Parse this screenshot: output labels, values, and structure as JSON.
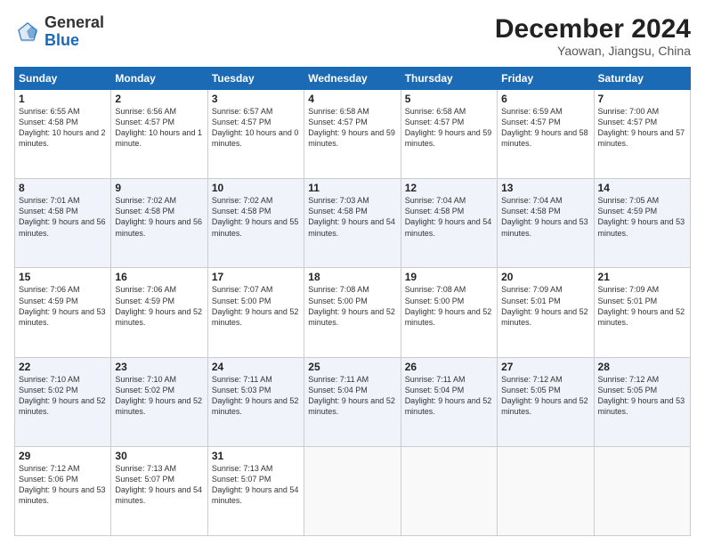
{
  "header": {
    "logo_general": "General",
    "logo_blue": "Blue",
    "month_title": "December 2024",
    "location": "Yaowan, Jiangsu, China"
  },
  "weekdays": [
    "Sunday",
    "Monday",
    "Tuesday",
    "Wednesday",
    "Thursday",
    "Friday",
    "Saturday"
  ],
  "weeks": [
    [
      {
        "day": "1",
        "sunrise": "Sunrise: 6:55 AM",
        "sunset": "Sunset: 4:58 PM",
        "daylight": "Daylight: 10 hours and 2 minutes."
      },
      {
        "day": "2",
        "sunrise": "Sunrise: 6:56 AM",
        "sunset": "Sunset: 4:57 PM",
        "daylight": "Daylight: 10 hours and 1 minute."
      },
      {
        "day": "3",
        "sunrise": "Sunrise: 6:57 AM",
        "sunset": "Sunset: 4:57 PM",
        "daylight": "Daylight: 10 hours and 0 minutes."
      },
      {
        "day": "4",
        "sunrise": "Sunrise: 6:58 AM",
        "sunset": "Sunset: 4:57 PM",
        "daylight": "Daylight: 9 hours and 59 minutes."
      },
      {
        "day": "5",
        "sunrise": "Sunrise: 6:58 AM",
        "sunset": "Sunset: 4:57 PM",
        "daylight": "Daylight: 9 hours and 59 minutes."
      },
      {
        "day": "6",
        "sunrise": "Sunrise: 6:59 AM",
        "sunset": "Sunset: 4:57 PM",
        "daylight": "Daylight: 9 hours and 58 minutes."
      },
      {
        "day": "7",
        "sunrise": "Sunrise: 7:00 AM",
        "sunset": "Sunset: 4:57 PM",
        "daylight": "Daylight: 9 hours and 57 minutes."
      }
    ],
    [
      {
        "day": "8",
        "sunrise": "Sunrise: 7:01 AM",
        "sunset": "Sunset: 4:58 PM",
        "daylight": "Daylight: 9 hours and 56 minutes."
      },
      {
        "day": "9",
        "sunrise": "Sunrise: 7:02 AM",
        "sunset": "Sunset: 4:58 PM",
        "daylight": "Daylight: 9 hours and 56 minutes."
      },
      {
        "day": "10",
        "sunrise": "Sunrise: 7:02 AM",
        "sunset": "Sunset: 4:58 PM",
        "daylight": "Daylight: 9 hours and 55 minutes."
      },
      {
        "day": "11",
        "sunrise": "Sunrise: 7:03 AM",
        "sunset": "Sunset: 4:58 PM",
        "daylight": "Daylight: 9 hours and 54 minutes."
      },
      {
        "day": "12",
        "sunrise": "Sunrise: 7:04 AM",
        "sunset": "Sunset: 4:58 PM",
        "daylight": "Daylight: 9 hours and 54 minutes."
      },
      {
        "day": "13",
        "sunrise": "Sunrise: 7:04 AM",
        "sunset": "Sunset: 4:58 PM",
        "daylight": "Daylight: 9 hours and 53 minutes."
      },
      {
        "day": "14",
        "sunrise": "Sunrise: 7:05 AM",
        "sunset": "Sunset: 4:59 PM",
        "daylight": "Daylight: 9 hours and 53 minutes."
      }
    ],
    [
      {
        "day": "15",
        "sunrise": "Sunrise: 7:06 AM",
        "sunset": "Sunset: 4:59 PM",
        "daylight": "Daylight: 9 hours and 53 minutes."
      },
      {
        "day": "16",
        "sunrise": "Sunrise: 7:06 AM",
        "sunset": "Sunset: 4:59 PM",
        "daylight": "Daylight: 9 hours and 52 minutes."
      },
      {
        "day": "17",
        "sunrise": "Sunrise: 7:07 AM",
        "sunset": "Sunset: 5:00 PM",
        "daylight": "Daylight: 9 hours and 52 minutes."
      },
      {
        "day": "18",
        "sunrise": "Sunrise: 7:08 AM",
        "sunset": "Sunset: 5:00 PM",
        "daylight": "Daylight: 9 hours and 52 minutes."
      },
      {
        "day": "19",
        "sunrise": "Sunrise: 7:08 AM",
        "sunset": "Sunset: 5:00 PM",
        "daylight": "Daylight: 9 hours and 52 minutes."
      },
      {
        "day": "20",
        "sunrise": "Sunrise: 7:09 AM",
        "sunset": "Sunset: 5:01 PM",
        "daylight": "Daylight: 9 hours and 52 minutes."
      },
      {
        "day": "21",
        "sunrise": "Sunrise: 7:09 AM",
        "sunset": "Sunset: 5:01 PM",
        "daylight": "Daylight: 9 hours and 52 minutes."
      }
    ],
    [
      {
        "day": "22",
        "sunrise": "Sunrise: 7:10 AM",
        "sunset": "Sunset: 5:02 PM",
        "daylight": "Daylight: 9 hours and 52 minutes."
      },
      {
        "day": "23",
        "sunrise": "Sunrise: 7:10 AM",
        "sunset": "Sunset: 5:02 PM",
        "daylight": "Daylight: 9 hours and 52 minutes."
      },
      {
        "day": "24",
        "sunrise": "Sunrise: 7:11 AM",
        "sunset": "Sunset: 5:03 PM",
        "daylight": "Daylight: 9 hours and 52 minutes."
      },
      {
        "day": "25",
        "sunrise": "Sunrise: 7:11 AM",
        "sunset": "Sunset: 5:04 PM",
        "daylight": "Daylight: 9 hours and 52 minutes."
      },
      {
        "day": "26",
        "sunrise": "Sunrise: 7:11 AM",
        "sunset": "Sunset: 5:04 PM",
        "daylight": "Daylight: 9 hours and 52 minutes."
      },
      {
        "day": "27",
        "sunrise": "Sunrise: 7:12 AM",
        "sunset": "Sunset: 5:05 PM",
        "daylight": "Daylight: 9 hours and 52 minutes."
      },
      {
        "day": "28",
        "sunrise": "Sunrise: 7:12 AM",
        "sunset": "Sunset: 5:05 PM",
        "daylight": "Daylight: 9 hours and 53 minutes."
      }
    ],
    [
      {
        "day": "29",
        "sunrise": "Sunrise: 7:12 AM",
        "sunset": "Sunset: 5:06 PM",
        "daylight": "Daylight: 9 hours and 53 minutes."
      },
      {
        "day": "30",
        "sunrise": "Sunrise: 7:13 AM",
        "sunset": "Sunset: 5:07 PM",
        "daylight": "Daylight: 9 hours and 54 minutes."
      },
      {
        "day": "31",
        "sunrise": "Sunrise: 7:13 AM",
        "sunset": "Sunset: 5:07 PM",
        "daylight": "Daylight: 9 hours and 54 minutes."
      },
      null,
      null,
      null,
      null
    ]
  ]
}
